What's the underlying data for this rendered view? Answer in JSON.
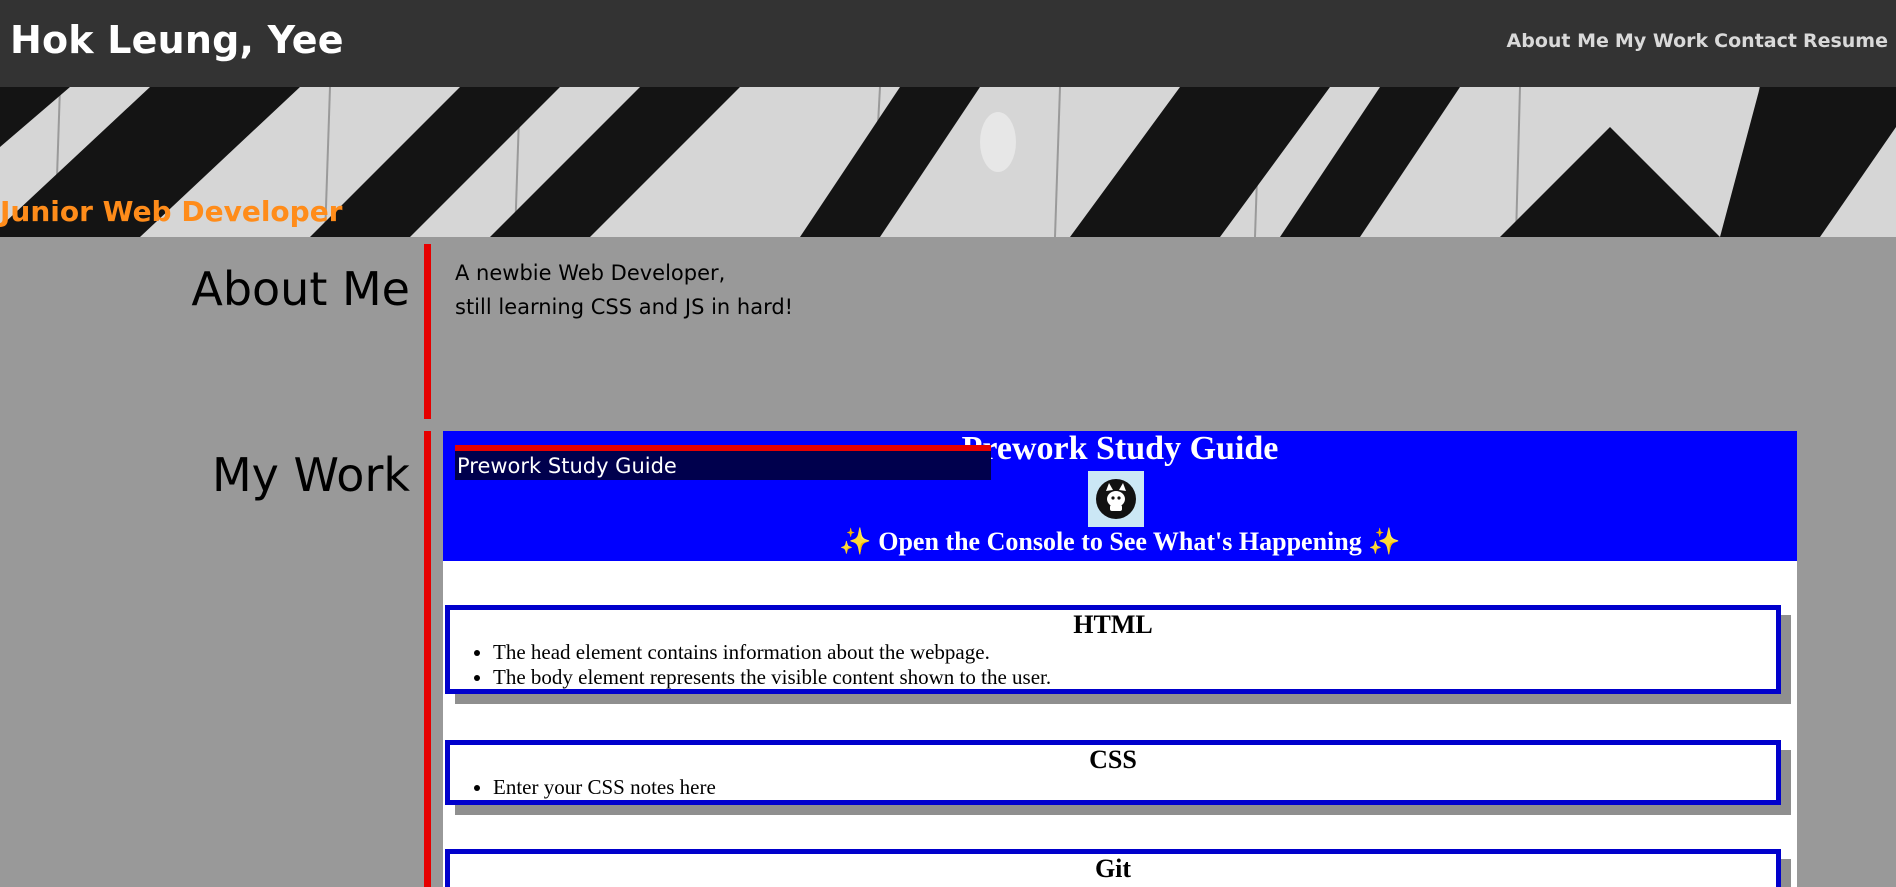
{
  "header": {
    "site_title": "Hok Leung, Yee",
    "nav": [
      "About Me",
      "My Work",
      "Contact",
      "Resume"
    ]
  },
  "hero": {
    "tagline": "Junior Web Developer",
    "tagline_color": "#ff8c1a"
  },
  "about": {
    "heading": "About Me",
    "lines": [
      "A newbie Web Developer,",
      "still learning CSS and JS in hard!"
    ]
  },
  "work": {
    "heading": "My Work",
    "project_caption": "Prework Study Guide",
    "preview": {
      "title": "Prework Study Guide",
      "subtitle": "✨ Open the Console to See What's Happening ✨",
      "icon": "cat-icon",
      "cards": [
        {
          "title": "HTML",
          "items": [
            "The head element contains information about the webpage.",
            "The body element represents the visible content shown to the user."
          ]
        },
        {
          "title": "CSS",
          "items": [
            "Enter your CSS notes here"
          ]
        },
        {
          "title": "Git",
          "items": []
        }
      ]
    }
  },
  "colors": {
    "header_bg": "#333333",
    "page_bg": "#999999",
    "accent_red": "#e60000",
    "preview_blue": "#0000ff"
  }
}
